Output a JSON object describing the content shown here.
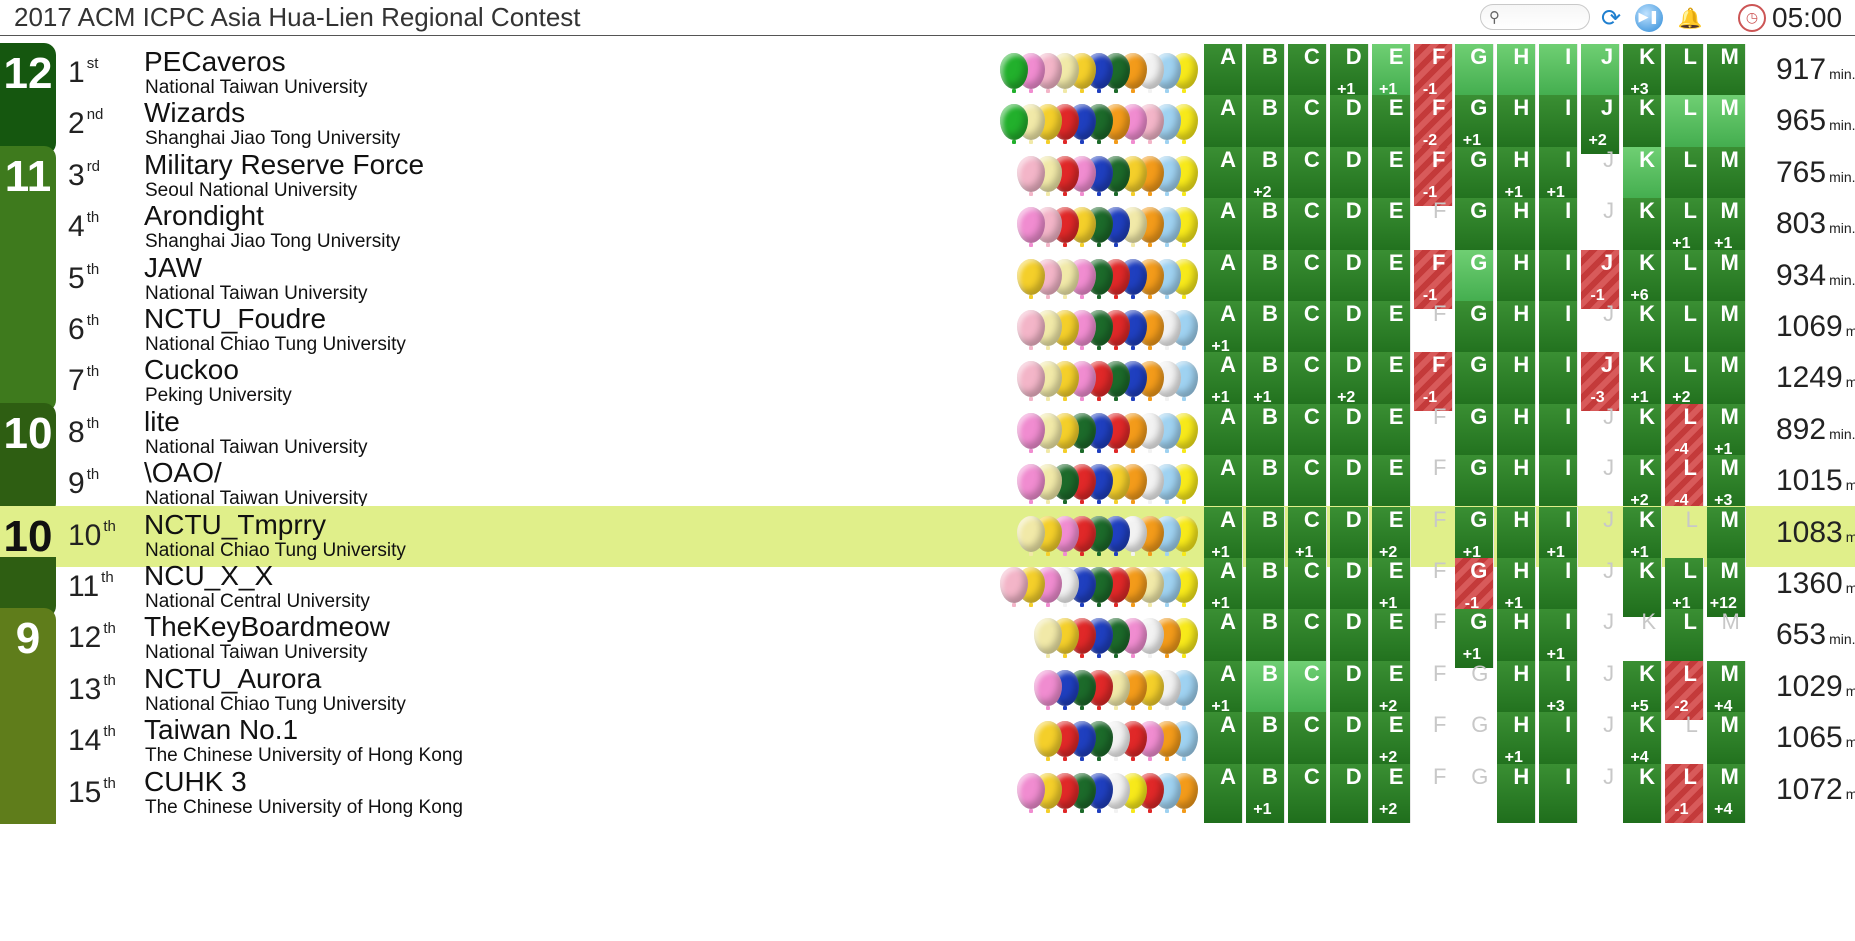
{
  "header": {
    "title": "2017 ACM ICPC Asia Hua-Lien Regional Contest",
    "search_placeholder": "",
    "timer": "05:00"
  },
  "problems": [
    "A",
    "B",
    "C",
    "D",
    "E",
    "F",
    "G",
    "H",
    "I",
    "J",
    "K",
    "L",
    "M"
  ],
  "time_unit": "min.",
  "colors": {
    "solved": "#2a7a25",
    "first_solve": "#52bb5a",
    "failed": "#cc4444",
    "highlight_row": "#e0ef8a"
  },
  "rows": [
    {
      "solved": "12",
      "rank": "1",
      "suffix": "st",
      "team": "PECaveros",
      "school": "National Taiwan University",
      "penalty": "917",
      "balloons": [
        "#22b02c",
        "#f08cd0",
        "#f3b5c8",
        "#f1e9a8",
        "#f4cf2a",
        "#1f3fbf",
        "#1c6a2a",
        "#f39b1a",
        "#f2f2f2",
        "#9fd2f1",
        "#f7e91a"
      ],
      "cells": [
        [
          "solved",
          ""
        ],
        [
          "solved",
          ""
        ],
        [
          "solved",
          ""
        ],
        [
          "solved",
          "+1"
        ],
        [
          "first",
          "+1"
        ],
        [
          "failed",
          "-1"
        ],
        [
          "first",
          ""
        ],
        [
          "first",
          ""
        ],
        [
          "first",
          ""
        ],
        [
          "first",
          ""
        ],
        [
          "solved",
          "+3"
        ],
        [
          "solved",
          ""
        ],
        [
          "solved",
          ""
        ]
      ]
    },
    {
      "solved": "",
      "rank": "2",
      "suffix": "nd",
      "team": "Wizards",
      "school": "Shanghai Jiao Tong University",
      "penalty": "965",
      "balloons": [
        "#22b02c",
        "#f1e9a8",
        "#f4cf2a",
        "#e02828",
        "#1f3fbf",
        "#1c6a2a",
        "#f39b1a",
        "#f08cd0",
        "#f3b5c8",
        "#9fd2f1",
        "#f7e91a"
      ],
      "cells": [
        [
          "solved",
          ""
        ],
        [
          "solved",
          ""
        ],
        [
          "solved",
          ""
        ],
        [
          "solved",
          ""
        ],
        [
          "solved",
          ""
        ],
        [
          "failed",
          "-2"
        ],
        [
          "solved",
          "+1"
        ],
        [
          "solved",
          ""
        ],
        [
          "solved",
          ""
        ],
        [
          "solved",
          "+2"
        ],
        [
          "solved",
          ""
        ],
        [
          "first",
          ""
        ],
        [
          "first",
          ""
        ]
      ]
    },
    {
      "solved": "11",
      "rank": "3",
      "suffix": "rd",
      "team": "Military Reserve Force",
      "school": "Seoul National University",
      "penalty": "765",
      "balloons": [
        "#f3b5c8",
        "#f1e9a8",
        "#e02828",
        "#f08cd0",
        "#1f3fbf",
        "#1c6a2a",
        "#f4cf2a",
        "#f39b1a",
        "#9fd2f1",
        "#f7e91a"
      ],
      "cells": [
        [
          "solved",
          ""
        ],
        [
          "solved",
          "+2"
        ],
        [
          "solved",
          ""
        ],
        [
          "solved",
          ""
        ],
        [
          "solved",
          ""
        ],
        [
          "failed",
          "-1"
        ],
        [
          "solved",
          ""
        ],
        [
          "solved",
          "+1"
        ],
        [
          "solved",
          "+1"
        ],
        [
          "none",
          ""
        ],
        [
          "first",
          ""
        ],
        [
          "solved",
          ""
        ],
        [
          "solved",
          ""
        ]
      ]
    },
    {
      "solved": "",
      "rank": "4",
      "suffix": "th",
      "team": "Arondight",
      "school": "Shanghai Jiao Tong University",
      "penalty": "803",
      "balloons": [
        "#f08cd0",
        "#f3b5c8",
        "#e02828",
        "#f4cf2a",
        "#1c6a2a",
        "#1f3fbf",
        "#f1e9a8",
        "#f39b1a",
        "#9fd2f1",
        "#f7e91a"
      ],
      "cells": [
        [
          "solved",
          ""
        ],
        [
          "solved",
          ""
        ],
        [
          "solved",
          ""
        ],
        [
          "solved",
          ""
        ],
        [
          "solved",
          ""
        ],
        [
          "none",
          ""
        ],
        [
          "solved",
          ""
        ],
        [
          "solved",
          ""
        ],
        [
          "solved",
          ""
        ],
        [
          "none",
          ""
        ],
        [
          "solved",
          ""
        ],
        [
          "solved",
          "+1"
        ],
        [
          "solved",
          "+1"
        ]
      ]
    },
    {
      "solved": "",
      "rank": "5",
      "suffix": "th",
      "team": "JAW",
      "school": "National Taiwan University",
      "penalty": "934",
      "balloons": [
        "#f4cf2a",
        "#f3b5c8",
        "#f1e9a8",
        "#f08cd0",
        "#1c6a2a",
        "#e02828",
        "#1f3fbf",
        "#f39b1a",
        "#9fd2f1",
        "#f7e91a"
      ],
      "cells": [
        [
          "solved",
          ""
        ],
        [
          "solved",
          ""
        ],
        [
          "solved",
          ""
        ],
        [
          "solved",
          ""
        ],
        [
          "solved",
          ""
        ],
        [
          "failed",
          "-1"
        ],
        [
          "first",
          ""
        ],
        [
          "solved",
          ""
        ],
        [
          "solved",
          ""
        ],
        [
          "failed",
          "-1"
        ],
        [
          "solved",
          "+6"
        ],
        [
          "solved",
          ""
        ],
        [
          "solved",
          ""
        ]
      ]
    },
    {
      "solved": "",
      "rank": "6",
      "suffix": "th",
      "team": "NCTU_Foudre",
      "school": "National Chiao Tung University",
      "penalty": "1069",
      "balloons": [
        "#f3b5c8",
        "#f1e9a8",
        "#f4cf2a",
        "#f08cd0",
        "#1c6a2a",
        "#e02828",
        "#1f3fbf",
        "#f39b1a",
        "#f2f2f2",
        "#9fd2f1"
      ],
      "cells": [
        [
          "solved",
          "+1"
        ],
        [
          "solved",
          ""
        ],
        [
          "solved",
          ""
        ],
        [
          "solved",
          ""
        ],
        [
          "solved",
          ""
        ],
        [
          "none",
          ""
        ],
        [
          "solved",
          ""
        ],
        [
          "solved",
          ""
        ],
        [
          "solved",
          ""
        ],
        [
          "none",
          ""
        ],
        [
          "solved",
          ""
        ],
        [
          "solved",
          ""
        ],
        [
          "solved",
          ""
        ]
      ]
    },
    {
      "solved": "",
      "rank": "7",
      "suffix": "th",
      "team": "Cuckoo",
      "school": "Peking University",
      "penalty": "1249",
      "balloons": [
        "#f3b5c8",
        "#f1e9a8",
        "#f4cf2a",
        "#f08cd0",
        "#e02828",
        "#1c6a2a",
        "#1f3fbf",
        "#f39b1a",
        "#f2f2f2",
        "#9fd2f1"
      ],
      "cells": [
        [
          "solved",
          "+1"
        ],
        [
          "solved",
          "+1"
        ],
        [
          "solved",
          ""
        ],
        [
          "solved",
          "+2"
        ],
        [
          "solved",
          ""
        ],
        [
          "failed",
          "-1"
        ],
        [
          "solved",
          ""
        ],
        [
          "solved",
          ""
        ],
        [
          "solved",
          ""
        ],
        [
          "failed",
          "-3"
        ],
        [
          "solved",
          "+1"
        ],
        [
          "solved",
          "+2"
        ],
        [
          "solved",
          ""
        ]
      ]
    },
    {
      "solved": "10",
      "rank": "8",
      "suffix": "th",
      "team": "lite",
      "school": "National Taiwan University",
      "penalty": "892",
      "balloons": [
        "#f08cd0",
        "#f1e9a8",
        "#f4cf2a",
        "#1c6a2a",
        "#1f3fbf",
        "#e02828",
        "#f39b1a",
        "#f2f2f2",
        "#9fd2f1",
        "#f7e91a"
      ],
      "cells": [
        [
          "solved",
          ""
        ],
        [
          "solved",
          ""
        ],
        [
          "solved",
          ""
        ],
        [
          "solved",
          ""
        ],
        [
          "solved",
          ""
        ],
        [
          "none",
          ""
        ],
        [
          "solved",
          ""
        ],
        [
          "solved",
          ""
        ],
        [
          "solved",
          ""
        ],
        [
          "none",
          ""
        ],
        [
          "solved",
          ""
        ],
        [
          "failed",
          "-4"
        ],
        [
          "solved",
          "+1"
        ]
      ]
    },
    {
      "solved": "",
      "rank": "9",
      "suffix": "th",
      "team": "\\OAO/",
      "school": "National Taiwan University",
      "penalty": "1015",
      "balloons": [
        "#f08cd0",
        "#f1e9a8",
        "#1c6a2a",
        "#e02828",
        "#1f3fbf",
        "#f4cf2a",
        "#f39b1a",
        "#f2f2f2",
        "#9fd2f1",
        "#f7e91a"
      ],
      "cells": [
        [
          "solved",
          ""
        ],
        [
          "solved",
          ""
        ],
        [
          "solved",
          ""
        ],
        [
          "solved",
          ""
        ],
        [
          "solved",
          ""
        ],
        [
          "none",
          ""
        ],
        [
          "solved",
          ""
        ],
        [
          "solved",
          ""
        ],
        [
          "solved",
          ""
        ],
        [
          "none",
          ""
        ],
        [
          "solved",
          "+2"
        ],
        [
          "failed",
          "-4"
        ],
        [
          "solved",
          "+3"
        ]
      ]
    },
    {
      "solved": "10",
      "rank": "10",
      "suffix": "th",
      "team": "NCTU_Tmprry",
      "school": "National Chiao Tung University",
      "penalty": "1083",
      "highlight": true,
      "balloons": [
        "#f1e9a8",
        "#f4cf2a",
        "#f08cd0",
        "#e02828",
        "#1c6a2a",
        "#1f3fbf",
        "#f2f2f2",
        "#f39b1a",
        "#9fd2f1",
        "#f7e91a"
      ],
      "cells": [
        [
          "solved",
          "+1"
        ],
        [
          "solved",
          ""
        ],
        [
          "solved",
          "+1"
        ],
        [
          "solved",
          ""
        ],
        [
          "solved",
          "+2"
        ],
        [
          "none",
          ""
        ],
        [
          "solved",
          "+1"
        ],
        [
          "solved",
          ""
        ],
        [
          "solved",
          "+1"
        ],
        [
          "none",
          ""
        ],
        [
          "solved",
          "+1"
        ],
        [
          "none",
          ""
        ],
        [
          "solved",
          ""
        ]
      ]
    },
    {
      "solved": "",
      "rank": "11",
      "suffix": "th",
      "team": "NCU_X_X",
      "school": "National Central University",
      "penalty": "1360",
      "balloons": [
        "#f3b5c8",
        "#f4cf2a",
        "#f08cd0",
        "#f2f2f2",
        "#1f3fbf",
        "#1c6a2a",
        "#e02828",
        "#f39b1a",
        "#f1e9a8",
        "#9fd2f1",
        "#f7e91a"
      ],
      "cells": [
        [
          "solved",
          "+1"
        ],
        [
          "solved",
          ""
        ],
        [
          "solved",
          ""
        ],
        [
          "solved",
          ""
        ],
        [
          "solved",
          "+1"
        ],
        [
          "none",
          ""
        ],
        [
          "failed",
          "-1"
        ],
        [
          "solved",
          "+1"
        ],
        [
          "solved",
          ""
        ],
        [
          "none",
          ""
        ],
        [
          "solved",
          ""
        ],
        [
          "solved",
          "+1"
        ],
        [
          "solved",
          "+12"
        ]
      ]
    },
    {
      "solved": "9",
      "rank": "12",
      "suffix": "th",
      "team": "TheKeyBoardmeow",
      "school": "National Taiwan University",
      "penalty": "653",
      "balloons": [
        "#f1e9a8",
        "#f4cf2a",
        "#e02828",
        "#1f3fbf",
        "#1c6a2a",
        "#f08cd0",
        "#f2f2f2",
        "#f39b1a",
        "#f7e91a"
      ],
      "cells": [
        [
          "solved",
          ""
        ],
        [
          "solved",
          ""
        ],
        [
          "solved",
          ""
        ],
        [
          "solved",
          ""
        ],
        [
          "solved",
          ""
        ],
        [
          "none",
          ""
        ],
        [
          "solved",
          "+1"
        ],
        [
          "solved",
          ""
        ],
        [
          "solved",
          "+1"
        ],
        [
          "none",
          ""
        ],
        [
          "none",
          ""
        ],
        [
          "solved",
          ""
        ],
        [
          "none",
          ""
        ]
      ]
    },
    {
      "solved": "",
      "rank": "13",
      "suffix": "th",
      "team": "NCTU_Aurora",
      "school": "National Chiao Tung University",
      "penalty": "1029",
      "balloons": [
        "#f08cd0",
        "#1f3fbf",
        "#1c6a2a",
        "#e02828",
        "#f1e9a8",
        "#f39b1a",
        "#f4cf2a",
        "#f2f2f2",
        "#9fd2f1"
      ],
      "cells": [
        [
          "solved",
          "+1"
        ],
        [
          "first",
          ""
        ],
        [
          "first",
          ""
        ],
        [
          "solved",
          ""
        ],
        [
          "solved",
          "+2"
        ],
        [
          "none",
          ""
        ],
        [
          "none",
          ""
        ],
        [
          "solved",
          ""
        ],
        [
          "solved",
          "+3"
        ],
        [
          "none",
          ""
        ],
        [
          "solved",
          "+5"
        ],
        [
          "failed",
          "-2"
        ],
        [
          "solved",
          "+4"
        ]
      ]
    },
    {
      "solved": "",
      "rank": "14",
      "suffix": "th",
      "team": "Taiwan No.1",
      "school": "The Chinese University of Hong Kong",
      "penalty": "1065",
      "balloons": [
        "#f4cf2a",
        "#e02828",
        "#1f3fbf",
        "#1c6a2a",
        "#f2f2f2",
        "#e02828",
        "#f08cd0",
        "#f39b1a",
        "#9fd2f1"
      ],
      "cells": [
        [
          "solved",
          ""
        ],
        [
          "solved",
          ""
        ],
        [
          "solved",
          ""
        ],
        [
          "solved",
          ""
        ],
        [
          "solved",
          "+2"
        ],
        [
          "none",
          ""
        ],
        [
          "none",
          ""
        ],
        [
          "solved",
          "+1"
        ],
        [
          "solved",
          ""
        ],
        [
          "none",
          ""
        ],
        [
          "solved",
          "+4"
        ],
        [
          "none",
          ""
        ],
        [
          "solved",
          ""
        ]
      ]
    },
    {
      "solved": "",
      "rank": "15",
      "suffix": "th",
      "team": "CUHK 3",
      "school": "The Chinese University of Hong Kong",
      "penalty": "1072",
      "balloons": [
        "#f08cd0",
        "#f4cf2a",
        "#e02828",
        "#1c6a2a",
        "#1f3fbf",
        "#f2f2f2",
        "#f7e91a",
        "#e02828",
        "#9fd2f1",
        "#f39b1a"
      ],
      "cells": [
        [
          "solved",
          ""
        ],
        [
          "solved",
          "+1"
        ],
        [
          "solved",
          ""
        ],
        [
          "solved",
          ""
        ],
        [
          "solved",
          "+2"
        ],
        [
          "none",
          ""
        ],
        [
          "none",
          ""
        ],
        [
          "solved",
          ""
        ],
        [
          "solved",
          ""
        ],
        [
          "none",
          ""
        ],
        [
          "solved",
          ""
        ],
        [
          "failed",
          "-1"
        ],
        [
          "solved",
          "+4"
        ]
      ]
    }
  ]
}
